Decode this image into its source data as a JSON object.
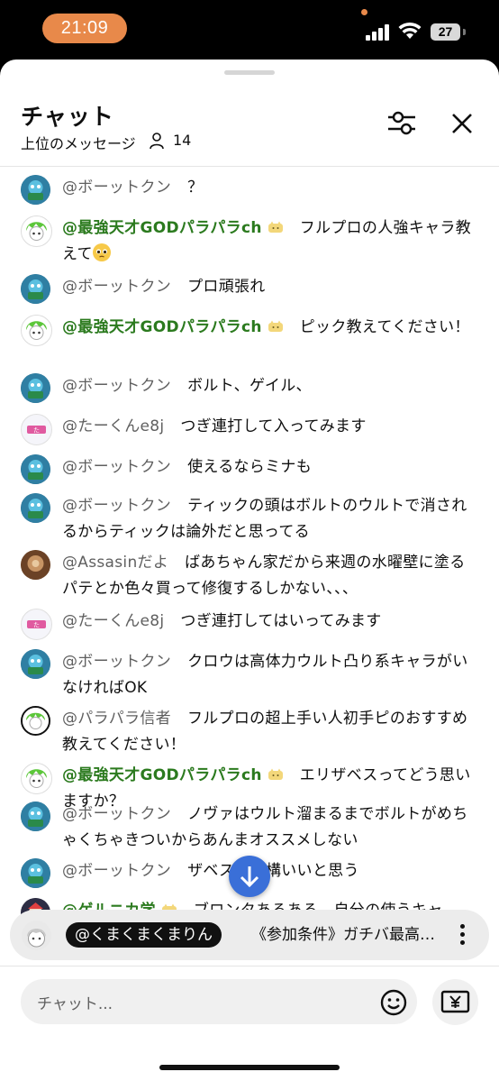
{
  "status_bar": {
    "time": "21:09",
    "battery": "27"
  },
  "header": {
    "title": "チャット",
    "subtitle": "上位のメッセージ",
    "viewer_count": "14"
  },
  "messages": [
    {
      "author": "@ボーットクン",
      "member": false,
      "text": "？",
      "avatar": "bot"
    },
    {
      "author": "@最強天才GODパラパラch",
      "member": true,
      "text": "フルプロの人強キャラ教えて",
      "emoji": "pleading-face",
      "avatar": "green"
    },
    {
      "author": "@ボーットクン",
      "member": false,
      "text": "プロ頑張れ",
      "avatar": "bot"
    },
    {
      "author": "@最強天才GODパラパラch",
      "member": true,
      "text": "ピック教えてください！",
      "avatar": "green"
    },
    {
      "author": "@ボーットクン",
      "member": false,
      "text": "ボルト、ゲイル、",
      "avatar": "bot"
    },
    {
      "author": "@たーくんe8j",
      "member": false,
      "text": "つぎ連打して入ってみます",
      "avatar": "tak"
    },
    {
      "author": "@ボーットクン",
      "member": false,
      "text": "使えるならミナも",
      "avatar": "bot"
    },
    {
      "author": "@ボーットクン",
      "member": false,
      "text": "ティックの頭はボルトのウルトで消されるからティックは論外だと思ってる",
      "avatar": "bot"
    },
    {
      "author": "@Assasinだよ",
      "member": false,
      "text": "ばあちゃん家だから来週の水曜壁に塗るパテとか色々買って修復するしかない、、、",
      "avatar": "assa"
    },
    {
      "author": "@たーくんe8j",
      "member": false,
      "text": "つぎ連打してはいってみます",
      "avatar": "tak"
    },
    {
      "author": "@ボーットクン",
      "member": false,
      "text": "クロウは高体力ウルト凸り系キャラがいなければOK",
      "avatar": "bot"
    },
    {
      "author": "@パラパラ信者",
      "member": false,
      "text": "フルプロの超上手い人初手ピのおすすめ教えてください！",
      "avatar": "para"
    },
    {
      "author": "@最強天才GODパラパラch",
      "member": true,
      "text": "エリザベスってどう思いますか？",
      "avatar": "green"
    },
    {
      "author": "@ボーットクン",
      "member": false,
      "text": "ノヴァはウルト溜まるまでボルトがめちゃくちゃきついからあんまオススメしない",
      "avatar": "bot"
    },
    {
      "author": "@ボーットクン",
      "member": false,
      "text": "ザベスも結構いいと思う",
      "avatar": "bot"
    },
    {
      "author": "@ゲルニカ学",
      "member": true,
      "text": "ブロンタあるある、自分の使うキャ",
      "avatar": "geru"
    }
  ],
  "pinned": {
    "author": "@くまくまくまりん",
    "text": "《参加条件》ガチバ最高…"
  },
  "input": {
    "placeholder": "チャット..."
  },
  "colors": {
    "member_name": "#2b7a1e",
    "scroll_button": "#3a6fd8",
    "time_pill": "#e8894a"
  },
  "icons": [
    "person-icon",
    "tune-icon",
    "close-icon",
    "arrow-down-icon",
    "kebab-icon",
    "smile-icon",
    "yen-icon",
    "member-badge-icon"
  ]
}
